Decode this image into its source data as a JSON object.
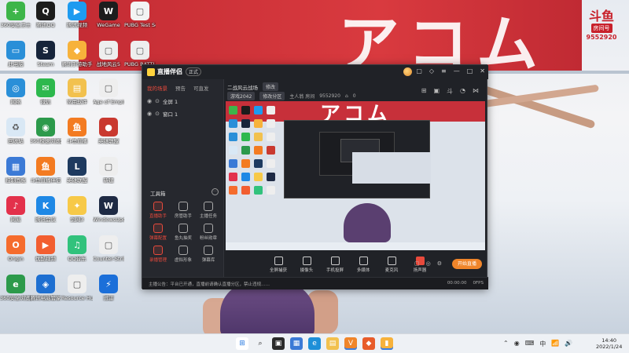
{
  "desktop": {
    "icons": [
      {
        "label": "360安全卫士",
        "color": "#3db549",
        "glyph": "+"
      },
      {
        "label": "腾讯QQ",
        "color": "#1c1c1c",
        "glyph": "Q"
      },
      {
        "label": "腾讯视频",
        "color": "#1d9bf0",
        "glyph": "▶"
      },
      {
        "label": "WeGame",
        "color": "#1d1d1d",
        "glyph": "W"
      },
      {
        "label": "PUBG Test Server",
        "color": "#f3f3f3",
        "glyph": "▢"
      },
      {
        "label": "此电脑",
        "color": "#2a8fd8",
        "glyph": "▭"
      },
      {
        "label": "Steam",
        "color": "#16243a",
        "glyph": "S"
      },
      {
        "label": "腾讯手游助手",
        "color": "#f7b23b",
        "glyph": "◆"
      },
      {
        "label": "战地风云5",
        "color": "#eeeeee",
        "glyph": "▢"
      },
      {
        "label": "PUBG BATTLE",
        "color": "#eeeeee",
        "glyph": "▢"
      },
      {
        "label": "网络",
        "color": "#2a8fd8",
        "glyph": "◎"
      },
      {
        "label": "微信",
        "color": "#2db84d",
        "glyph": "✉"
      },
      {
        "label": "常用软件",
        "color": "#f2c14e",
        "glyph": "▤"
      },
      {
        "label": "Age of Empires ...",
        "color": "#eeeeee",
        "glyph": "▢"
      },
      {
        "label": "回收站",
        "color": "#d9e8f5",
        "glyph": "♻"
      },
      {
        "label": "360极速浏览器",
        "color": "#2c9a4b",
        "glyph": "◉"
      },
      {
        "label": "斗鱼直播",
        "color": "#f37b21",
        "glyph": "鱼"
      },
      {
        "label": "英雄联盟",
        "color": "#c9392f",
        "glyph": "●"
      },
      {
        "label": "控制面板",
        "color": "#3b7ad6",
        "glyph": "▦"
      },
      {
        "label": "斗鱼直播伴侣",
        "color": "#f37b21",
        "glyph": "鱼"
      },
      {
        "label": "英雄联盟",
        "color": "#1e3a5f",
        "glyph": "L"
      },
      {
        "label": "新建",
        "color": "#eeeeee",
        "glyph": "▢"
      },
      {
        "label": "网易",
        "color": "#e3314b",
        "glyph": "♪"
      },
      {
        "label": "腾讯会议",
        "color": "#1e88e5",
        "glyph": "K"
      },
      {
        "label": "剑网3",
        "color": "#f7c948",
        "glyph": "✦"
      },
      {
        "label": "WindowsUpdate",
        "color": "#1e2a44",
        "glyph": "W"
      },
      {
        "label": "Origin",
        "color": "#f56c2d",
        "glyph": "O"
      },
      {
        "label": "优酷视频",
        "color": "#f25e30",
        "glyph": "▶"
      },
      {
        "label": "QQ音乐",
        "color": "#31c27c",
        "glyph": "♫"
      },
      {
        "label": "Counter-Strike ...",
        "color": "#eeeeee",
        "glyph": "▢"
      },
      {
        "label": "360安全浏览器",
        "color": "#2c9a4b",
        "glyph": "e"
      },
      {
        "label": "腾讯电脑管家",
        "color": "#1d6fd1",
        "glyph": "◈"
      },
      {
        "label": "Resource Hunter",
        "color": "#eeeeee",
        "glyph": "▢"
      },
      {
        "label": "迅雷",
        "color": "#1b6fd9",
        "glyph": "⚡"
      }
    ]
  },
  "watermark": {
    "logo": "斗鱼",
    "badge": "房间号",
    "room": "9552920"
  },
  "app": {
    "name": "直播伴侣",
    "version": "正式",
    "left_tabs": [
      "我的场景",
      "预告",
      "可直发"
    ],
    "scenes": [
      "全屏 1",
      "窗口 1"
    ],
    "tools_title": "工具箱",
    "tools_more": "···",
    "tools": [
      {
        "label": "直播助手",
        "red": true
      },
      {
        "label": "房管助手",
        "red": false
      },
      {
        "label": "主播任务",
        "red": false
      },
      {
        "label": "弹幕配置",
        "red": true
      },
      {
        "label": "鱼丸抽奖",
        "red": false
      },
      {
        "label": "粉丝勋章",
        "red": false
      },
      {
        "label": "录播管理",
        "red": true
      },
      {
        "label": "虚拟形象",
        "red": false
      },
      {
        "label": "弹幕库",
        "red": false
      }
    ],
    "room_title": "二战风云战场",
    "room_tag": "修改",
    "category": "游戏2042",
    "category_tag": "修改分区",
    "room_label": "主人翁 房间",
    "room_id": "9552920",
    "hot": "0",
    "controls": [
      "全屏捕获",
      "摄像头",
      "手机投屏",
      "多媒体",
      "麦克风",
      "扬声器"
    ],
    "start_live": "开始直播",
    "status_message": "主播公告：平台已开通，直播前请确认直播分区，禁止违规……",
    "status_time": "00:00:00",
    "status_fps": "0FPS"
  },
  "taskbar": {
    "time": "14:40",
    "date": "2022/1/24",
    "tray": [
      "⌃",
      "◉",
      "⌨",
      "中",
      "📶",
      "🔊"
    ]
  }
}
